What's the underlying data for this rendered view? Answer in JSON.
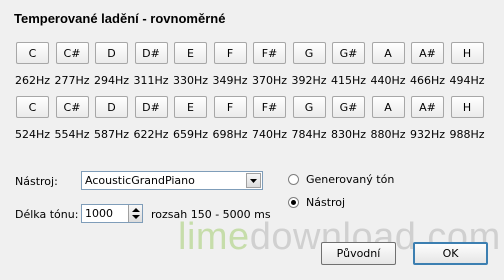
{
  "title": "Temperované ladění - rovnoměrné",
  "row1": {
    "notes": [
      "C",
      "C#",
      "D",
      "D#",
      "E",
      "F",
      "F#",
      "G",
      "G#",
      "A",
      "A#",
      "H"
    ],
    "freqs": [
      "262Hz",
      "277Hz",
      "294Hz",
      "311Hz",
      "330Hz",
      "349Hz",
      "370Hz",
      "392Hz",
      "415Hz",
      "440Hz",
      "466Hz",
      "494Hz"
    ]
  },
  "row2": {
    "notes": [
      "C",
      "C#",
      "D",
      "D#",
      "E",
      "F",
      "F#",
      "G",
      "G#",
      "A",
      "A#",
      "H"
    ],
    "freqs": [
      "524Hz",
      "554Hz",
      "587Hz",
      "622Hz",
      "659Hz",
      "698Hz",
      "740Hz",
      "784Hz",
      "830Hz",
      "880Hz",
      "932Hz",
      "988Hz"
    ]
  },
  "instrument": {
    "label": "Nástroj:",
    "value": "AcousticGrandPiano"
  },
  "duration": {
    "label": "Délka tónu:",
    "value": "1000",
    "range": "rozsah 150 - 5000 ms"
  },
  "radios": [
    {
      "label": "Generovaný tón",
      "checked": false
    },
    {
      "label": "Nástroj",
      "checked": true
    }
  ],
  "buttons": {
    "original": "Původní",
    "ok": "OK"
  },
  "watermark": {
    "lime": "lime",
    "rest": "download.com"
  },
  "icons": {
    "dropdown": "chevron-down-icon",
    "spin": "spin-arrows-icon"
  }
}
